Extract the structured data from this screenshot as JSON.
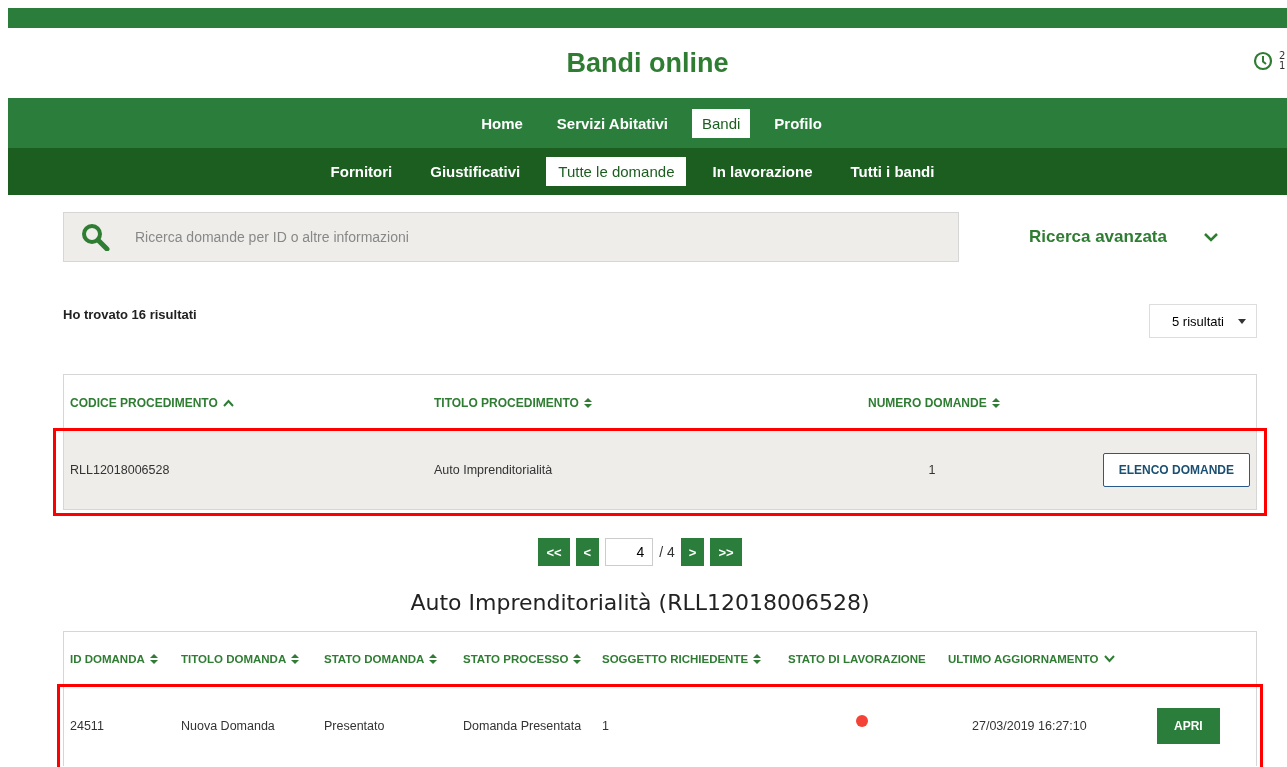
{
  "header": {
    "title": "Bandi online",
    "clock_lines": [
      "2",
      "1"
    ]
  },
  "nav": [
    {
      "label": "Home",
      "selected": false
    },
    {
      "label": "Servizi Abitativi",
      "selected": false
    },
    {
      "label": "Bandi",
      "selected": true
    },
    {
      "label": "Profilo",
      "selected": false
    }
  ],
  "subnav": [
    {
      "label": "Fornitori",
      "selected": false
    },
    {
      "label": "Giustificativi",
      "selected": false
    },
    {
      "label": "Tutte le domande",
      "selected": true
    },
    {
      "label": "In lavorazione",
      "selected": false
    },
    {
      "label": "Tutti i bandi",
      "selected": false
    }
  ],
  "search": {
    "placeholder": "Ricerca domande per ID o altre informazioni",
    "advanced_label": "Ricerca avanzata",
    "expanded": false
  },
  "results": {
    "summary": "Ho trovato 16 risultati",
    "page_size": "5 risultati"
  },
  "procedures_table": {
    "columns": [
      {
        "label": "CODICE PROCEDIMENTO",
        "sortable": true,
        "sorted_ascending": true,
        "sorted_descending": false
      },
      {
        "label": "TITOLO PROCEDIMENTO",
        "sortable": true,
        "sorted_ascending": false,
        "sorted_descending": false
      },
      {
        "label": "NUMERO DOMANDE",
        "sortable": true,
        "sorted_ascending": false,
        "sorted_descending": false
      }
    ],
    "rows": [
      {
        "cells": [
          "RLL12018006528",
          "Auto Imprenditorialità",
          "1"
        ],
        "action": "ELENCO DOMANDE",
        "highlighted": true,
        "selected": true
      }
    ]
  },
  "pagination": {
    "first": "<<",
    "prev": "<",
    "page": "4",
    "total": "/ 4",
    "next": ">",
    "last": ">>"
  },
  "detail_title": "Auto Imprenditorialità (RLL12018006528)",
  "applications_table": {
    "columns": [
      {
        "label": "ID DOMANDA",
        "sortable": true,
        "sorted_ascending": false,
        "sorted_descending": false
      },
      {
        "label": "TITOLO DOMANDA",
        "sortable": true,
        "sorted_ascending": false,
        "sorted_descending": false
      },
      {
        "label": "STATO DOMANDA",
        "sortable": true,
        "sorted_ascending": false,
        "sorted_descending": false
      },
      {
        "label": "STATO PROCESSO",
        "sortable": true,
        "sorted_ascending": false,
        "sorted_descending": false
      },
      {
        "label": "SOGGETTO RICHIEDENTE",
        "sortable": true,
        "sorted_ascending": false,
        "sorted_descending": false
      },
      {
        "label": "STATO DI LAVORAZIONE",
        "sortable": false
      },
      {
        "label": "ULTIMO AGGIORNAMENTO",
        "sortable": true,
        "sorted_ascending": false,
        "sorted_descending": true
      }
    ],
    "rows": [
      {
        "cells": [
          "24511",
          "Nuova Domanda",
          "Presentato",
          "Domanda Presentata",
          "1"
        ],
        "color": "#f44336",
        "updated": "27/03/2019 16:27:10",
        "action": "APRI",
        "highlighted": true
      }
    ]
  }
}
